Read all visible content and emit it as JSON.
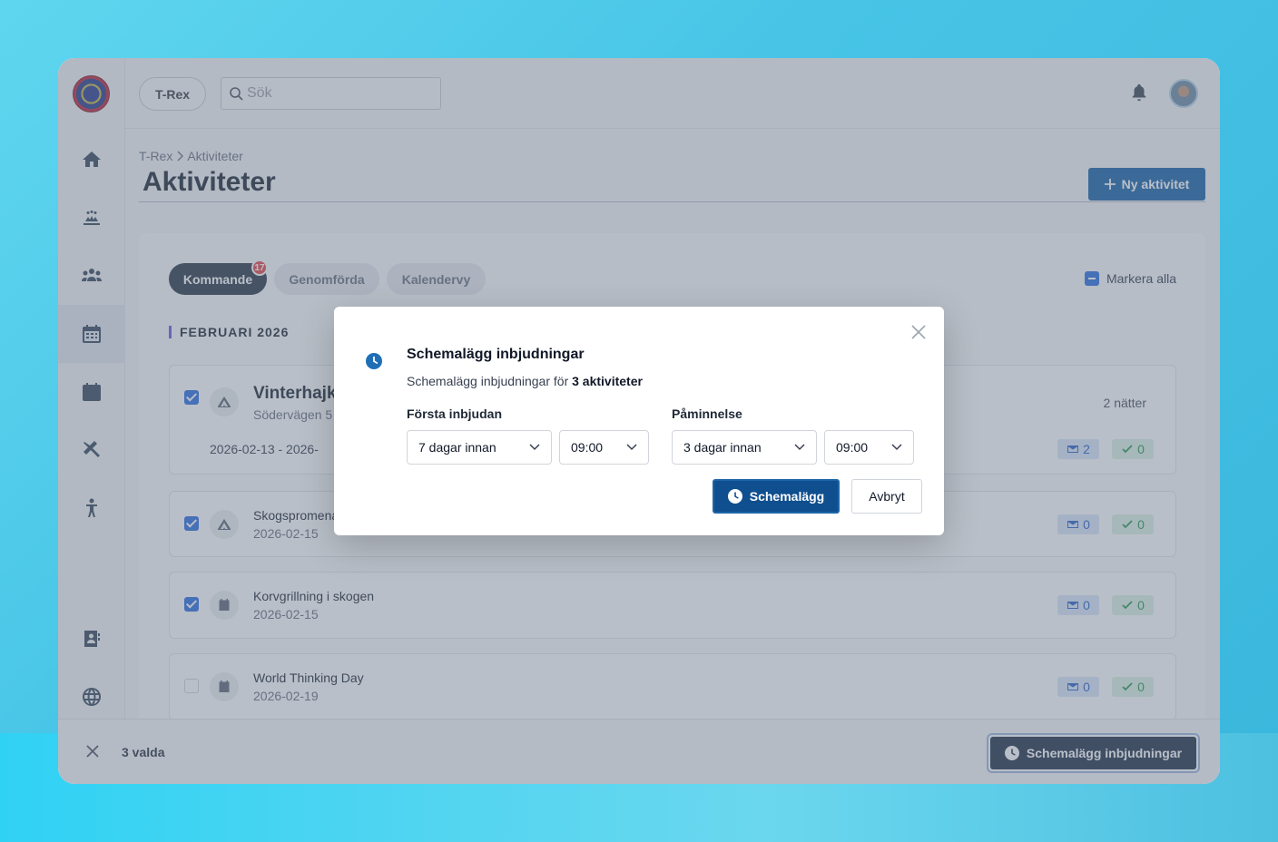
{
  "topbar": {
    "org": "T-Rex",
    "search_placeholder": "Sök"
  },
  "breadcrumb": {
    "root": "T-Rex",
    "current": "Aktiviteter"
  },
  "page": {
    "title": "Aktiviteter",
    "new_button": "Ny aktivitet"
  },
  "tabs": [
    {
      "label": "Kommande",
      "badge": "17"
    },
    {
      "label": "Genomförda"
    },
    {
      "label": "Kalendervy"
    }
  ],
  "select_all": "Markera alla",
  "month": "FEBRUARI 2026",
  "activities": [
    {
      "title": "Vinterhajk",
      "subtitle": "Södervägen 5",
      "dates": "2026-02-13 - 2026-",
      "nights": "2 nätter",
      "mail": "2",
      "ok": "0",
      "checked": true
    },
    {
      "title": "Skogspromenad",
      "subtitle": "2026-02-15",
      "mail": "0",
      "ok": "0",
      "checked": true
    },
    {
      "title": "Korvgrillning i skogen",
      "subtitle": "2026-02-15",
      "mail": "0",
      "ok": "0",
      "checked": true
    },
    {
      "title": "World Thinking Day",
      "subtitle": "2026-02-19",
      "mail": "0",
      "ok": "0",
      "checked": false
    }
  ],
  "bottombar": {
    "count": "3 valda",
    "action": "Schemalägg inbjudningar"
  },
  "modal": {
    "title": "Schemalägg inbjudningar",
    "desc_prefix": "Schemalägg inbjudningar för ",
    "desc_bold": "3 aktiviteter",
    "first_label": "Första inbjudan",
    "first_days": "7 dagar innan",
    "first_time": "09:00",
    "reminder_label": "Påminnelse",
    "reminder_days": "3 dagar innan",
    "reminder_time": "09:00",
    "submit": "Schemalägg",
    "cancel": "Avbryt"
  },
  "colors": {
    "primary": "#0f4f8f",
    "accent": "#1d65a8",
    "checkbox": "#2f6fe0",
    "badge": "#e5484d"
  },
  "icons": [
    "home-icon",
    "campfire-icon",
    "group-icon",
    "calendar-grid-icon",
    "calendar-icon",
    "tools-icon",
    "person-icon",
    "contacts-icon",
    "globe-icon",
    "bell-icon",
    "search-icon",
    "clock-icon",
    "close-icon",
    "tent-icon",
    "mail-icon",
    "check-icon"
  ]
}
